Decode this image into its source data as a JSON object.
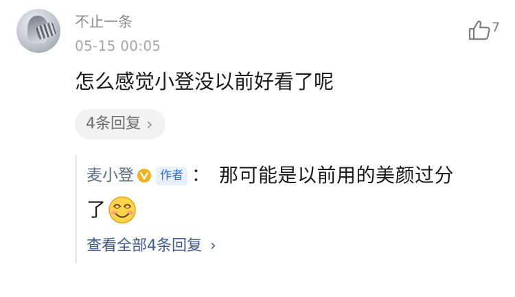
{
  "comment": {
    "username": "不止一条",
    "timestamp": "05-15 00:05",
    "like_icon": "thumbs-up-outline",
    "like_count": "7",
    "text": "怎么感觉小登没以前好看了呢",
    "replies_button_label": "4条回复",
    "replies_chevron": "›"
  },
  "reply": {
    "author": "麦小登",
    "verified_icon": "verified-v-badge",
    "author_badge": "作者",
    "colon": "：",
    "text_line1": "那可能是以前用的美颜过分",
    "text_line2": "了",
    "emoji": "smiling-face-emoji",
    "view_all_label": "查看全部4条回复",
    "view_all_chevron": "›"
  },
  "colors": {
    "verified_gold": "#f2b01e",
    "author_badge_text": "#2d6fd6",
    "link_blue": "#3d5a91"
  }
}
